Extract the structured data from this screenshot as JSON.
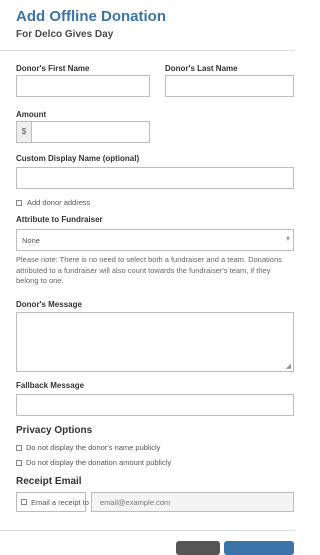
{
  "header": {
    "title": "Add Offline Donation",
    "subtitle": "For Delco Gives Day"
  },
  "form": {
    "first_name_label": "Donor's First Name",
    "last_name_label": "Donor's Last Name",
    "amount_label": "Amount",
    "amount_prefix": "$",
    "display_name_label": "Custom Display Name (optional)",
    "add_address_label": "Add donor address",
    "fundraiser_label": "Attribute to Fundraiser",
    "fundraiser_selected": "None",
    "fundraiser_note": "Please note: There is no need to select both a fundraiser and a team. Donations attributed to a fundraiser will also count towards the fundraiser's team, if they belong to one.",
    "message_label": "Donor's Message",
    "fallback_label": "Fallback Message"
  },
  "privacy": {
    "heading": "Privacy Options",
    "hide_name_label": "Do not display the donor's name publicly",
    "hide_amount_label": "Do not display the donation amount publicly"
  },
  "receipt": {
    "heading": "Receipt Email",
    "email_label": "Email a receipt to",
    "email_placeholder": "email@example.com"
  },
  "colors": {
    "title": "#3a74a8",
    "cancel_button": "#555555",
    "save_button": "#3a74a8"
  }
}
